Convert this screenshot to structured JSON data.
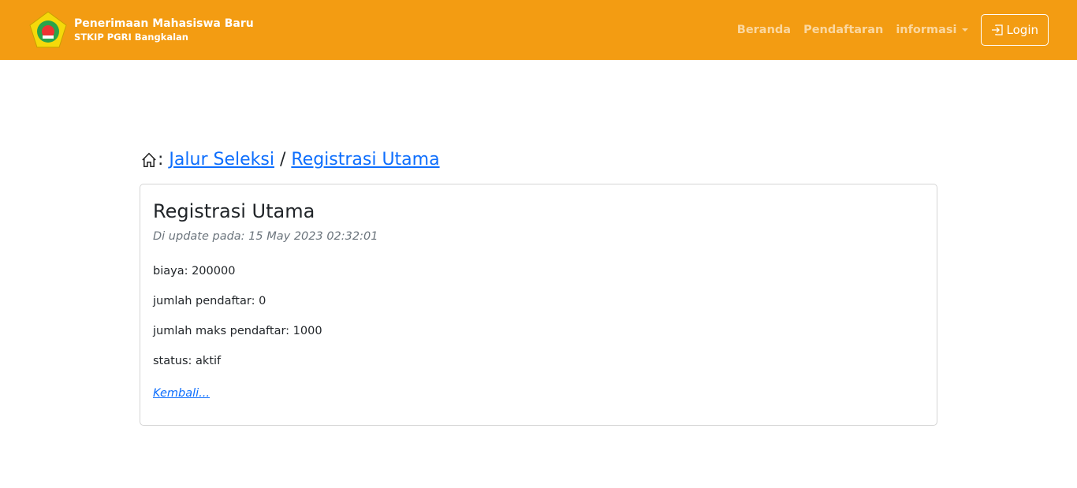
{
  "header": {
    "title": "Penerimaan Mahasiswa Baru",
    "subtitle": "STKIP PGRI Bangkalan",
    "nav": [
      {
        "label": "Beranda"
      },
      {
        "label": "Pendaftaran"
      },
      {
        "label": "informasi"
      }
    ],
    "login_label": "Login",
    "accent": "#f39c12"
  },
  "breadcrumb": {
    "sep1": ":",
    "item1": "Jalur Seleksi",
    "sep2": " / ",
    "item2": "Registrasi Utama"
  },
  "card": {
    "title": "Registrasi Utama",
    "updated": "Di update pada: 15 May 2023 02:32:01",
    "fields": [
      "biaya: 200000",
      "jumlah pendaftar: 0",
      "jumlah maks pendaftar: 1000",
      "status: aktif"
    ],
    "back_label": "Kembali..."
  }
}
